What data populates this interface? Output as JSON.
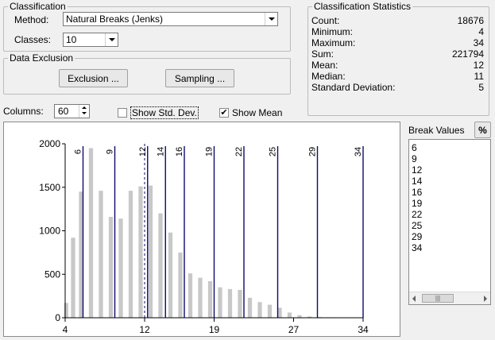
{
  "classification": {
    "title": "Classification",
    "method_label": "Method:",
    "method_value": "Natural Breaks (Jenks)",
    "classes_label": "Classes:",
    "classes_value": "10"
  },
  "data_exclusion": {
    "title": "Data Exclusion",
    "exclusion_button": "Exclusion ...",
    "sampling_button": "Sampling ..."
  },
  "statistics": {
    "title": "Classification Statistics",
    "rows": [
      {
        "label": "Count:",
        "value": "18676"
      },
      {
        "label": "Minimum:",
        "value": "4"
      },
      {
        "label": "Maximum:",
        "value": "34"
      },
      {
        "label": "Sum:",
        "value": "221794"
      },
      {
        "label": "Mean:",
        "value": "12"
      },
      {
        "label": "Median:",
        "value": "11"
      },
      {
        "label": "Standard Deviation:",
        "value": "5"
      }
    ]
  },
  "columns": {
    "label": "Columns:",
    "value": "60"
  },
  "show_std_dev": {
    "label": "Show Std. Dev.",
    "checked": false
  },
  "show_mean": {
    "label": "Show Mean",
    "checked": true
  },
  "break_values": {
    "title": "Break Values",
    "percent_button": "%",
    "items": [
      "6",
      "9",
      "12",
      "14",
      "16",
      "19",
      "22",
      "25",
      "29",
      "34"
    ],
    "scroll_grip": "|||"
  },
  "chart_data": {
    "type": "bar",
    "xlim": [
      4,
      34
    ],
    "ylim": [
      0,
      2000
    ],
    "x_ticks": [
      "4",
      "12",
      "19",
      "27",
      "34"
    ],
    "y_ticks": [
      "0",
      "500",
      "1000",
      "1500",
      "2000"
    ],
    "bar_width": 0.42,
    "bar_color": "#c8c8c8",
    "break_color": "#0a0a6e",
    "mean_value": 12,
    "bars": [
      {
        "x": 4.1,
        "y": 170
      },
      {
        "x": 4.8,
        "y": 920
      },
      {
        "x": 5.6,
        "y": 1450
      },
      {
        "x": 6.6,
        "y": 1950
      },
      {
        "x": 7.6,
        "y": 1460
      },
      {
        "x": 8.6,
        "y": 1160
      },
      {
        "x": 9.6,
        "y": 1140
      },
      {
        "x": 10.6,
        "y": 1460
      },
      {
        "x": 11.6,
        "y": 1510
      },
      {
        "x": 12.6,
        "y": 1520
      },
      {
        "x": 13.6,
        "y": 1200
      },
      {
        "x": 14.6,
        "y": 980
      },
      {
        "x": 15.6,
        "y": 750
      },
      {
        "x": 16.6,
        "y": 510
      },
      {
        "x": 17.6,
        "y": 460
      },
      {
        "x": 18.6,
        "y": 420
      },
      {
        "x": 19.6,
        "y": 350
      },
      {
        "x": 20.6,
        "y": 330
      },
      {
        "x": 21.6,
        "y": 320
      },
      {
        "x": 22.6,
        "y": 230
      },
      {
        "x": 23.6,
        "y": 180
      },
      {
        "x": 24.6,
        "y": 150
      },
      {
        "x": 25.6,
        "y": 115
      },
      {
        "x": 26.6,
        "y": 60
      },
      {
        "x": 27.6,
        "y": 30
      },
      {
        "x": 28.6,
        "y": 15
      },
      {
        "x": 29.6,
        "y": 8
      },
      {
        "x": 30.6,
        "y": 5
      },
      {
        "x": 31.6,
        "y": 4
      }
    ],
    "breaks": [
      {
        "value": 5.8,
        "label": "6"
      },
      {
        "value": 9.0,
        "label": "9"
      },
      {
        "value": 12.3,
        "label": "12"
      },
      {
        "value": 14.1,
        "label": "14"
      },
      {
        "value": 16.0,
        "label": "16"
      },
      {
        "value": 19.0,
        "label": "19"
      },
      {
        "value": 22.0,
        "label": "22"
      },
      {
        "value": 25.4,
        "label": "25"
      },
      {
        "value": 29.4,
        "label": "29"
      },
      {
        "value": 34.0,
        "label": "34"
      }
    ]
  }
}
